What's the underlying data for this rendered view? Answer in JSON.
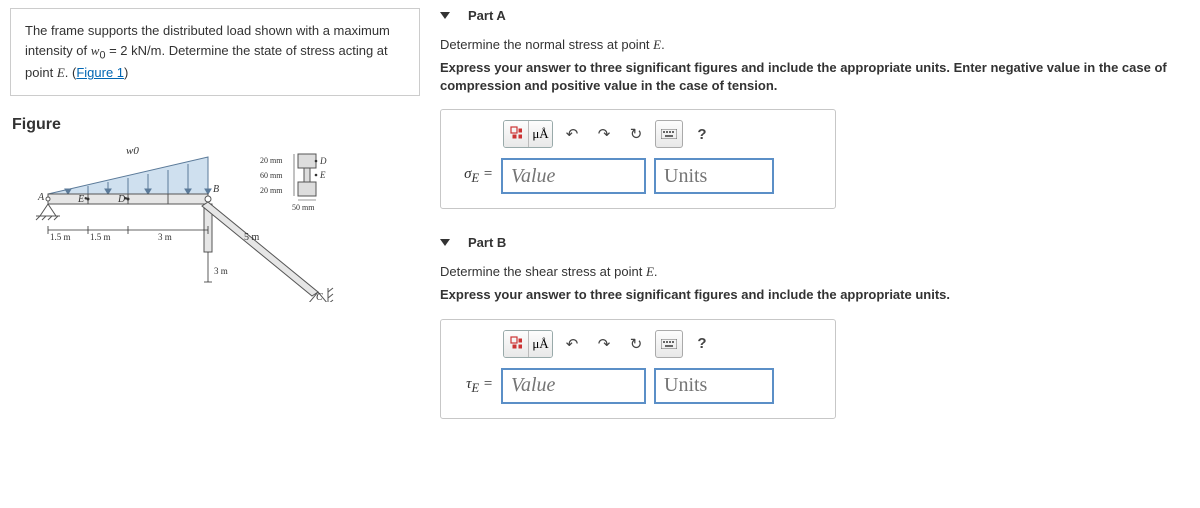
{
  "problem": {
    "text_1": "The frame supports the distributed load shown with a maximum intensity of ",
    "var": "w",
    "sub": "0",
    "eq": " = 2 kN/m",
    "text_2": ". Determine the state of stress acting at point ",
    "pointE": "E",
    "text_3": ". (",
    "link": "Figure 1",
    "text_4": ")"
  },
  "figure": {
    "title": "Figure",
    "labels": {
      "w0": "w0",
      "A": "A",
      "B": "B",
      "C": "C",
      "D": "D",
      "E": "E",
      "Edot": "E",
      "Ddot": "D",
      "d15a": "1.5 m",
      "d15b": "1.5 m",
      "d3a": "3 m",
      "d3b": "3 m",
      "d5": "5 m",
      "c20a": "20 mm",
      "c60": "60 mm",
      "c20b": "20 mm",
      "c50": "50 mm"
    }
  },
  "partA": {
    "title": "Part A",
    "prompt_1": "Determine the normal stress at point ",
    "prompt_pt": "E",
    "prompt_2": ".",
    "instr": "Express your answer to three significant figures and include the appropriate units. Enter negative value in the case of compression and positive value in the case of tension.",
    "mu": "μÅ",
    "eq_html": "σE =",
    "val_ph": "Value",
    "unit_ph": "Units"
  },
  "partB": {
    "title": "Part B",
    "prompt_1": "Determine the shear stress at point ",
    "prompt_pt": "E",
    "prompt_2": ".",
    "instr": "Express your answer to three significant figures and include the appropriate units.",
    "mu": "μÅ",
    "eq_html": "τE =",
    "val_ph": "Value",
    "unit_ph": "Units"
  },
  "icons": {
    "help": "?",
    "undo": "↶",
    "redo": "↷",
    "reset": "↻"
  }
}
